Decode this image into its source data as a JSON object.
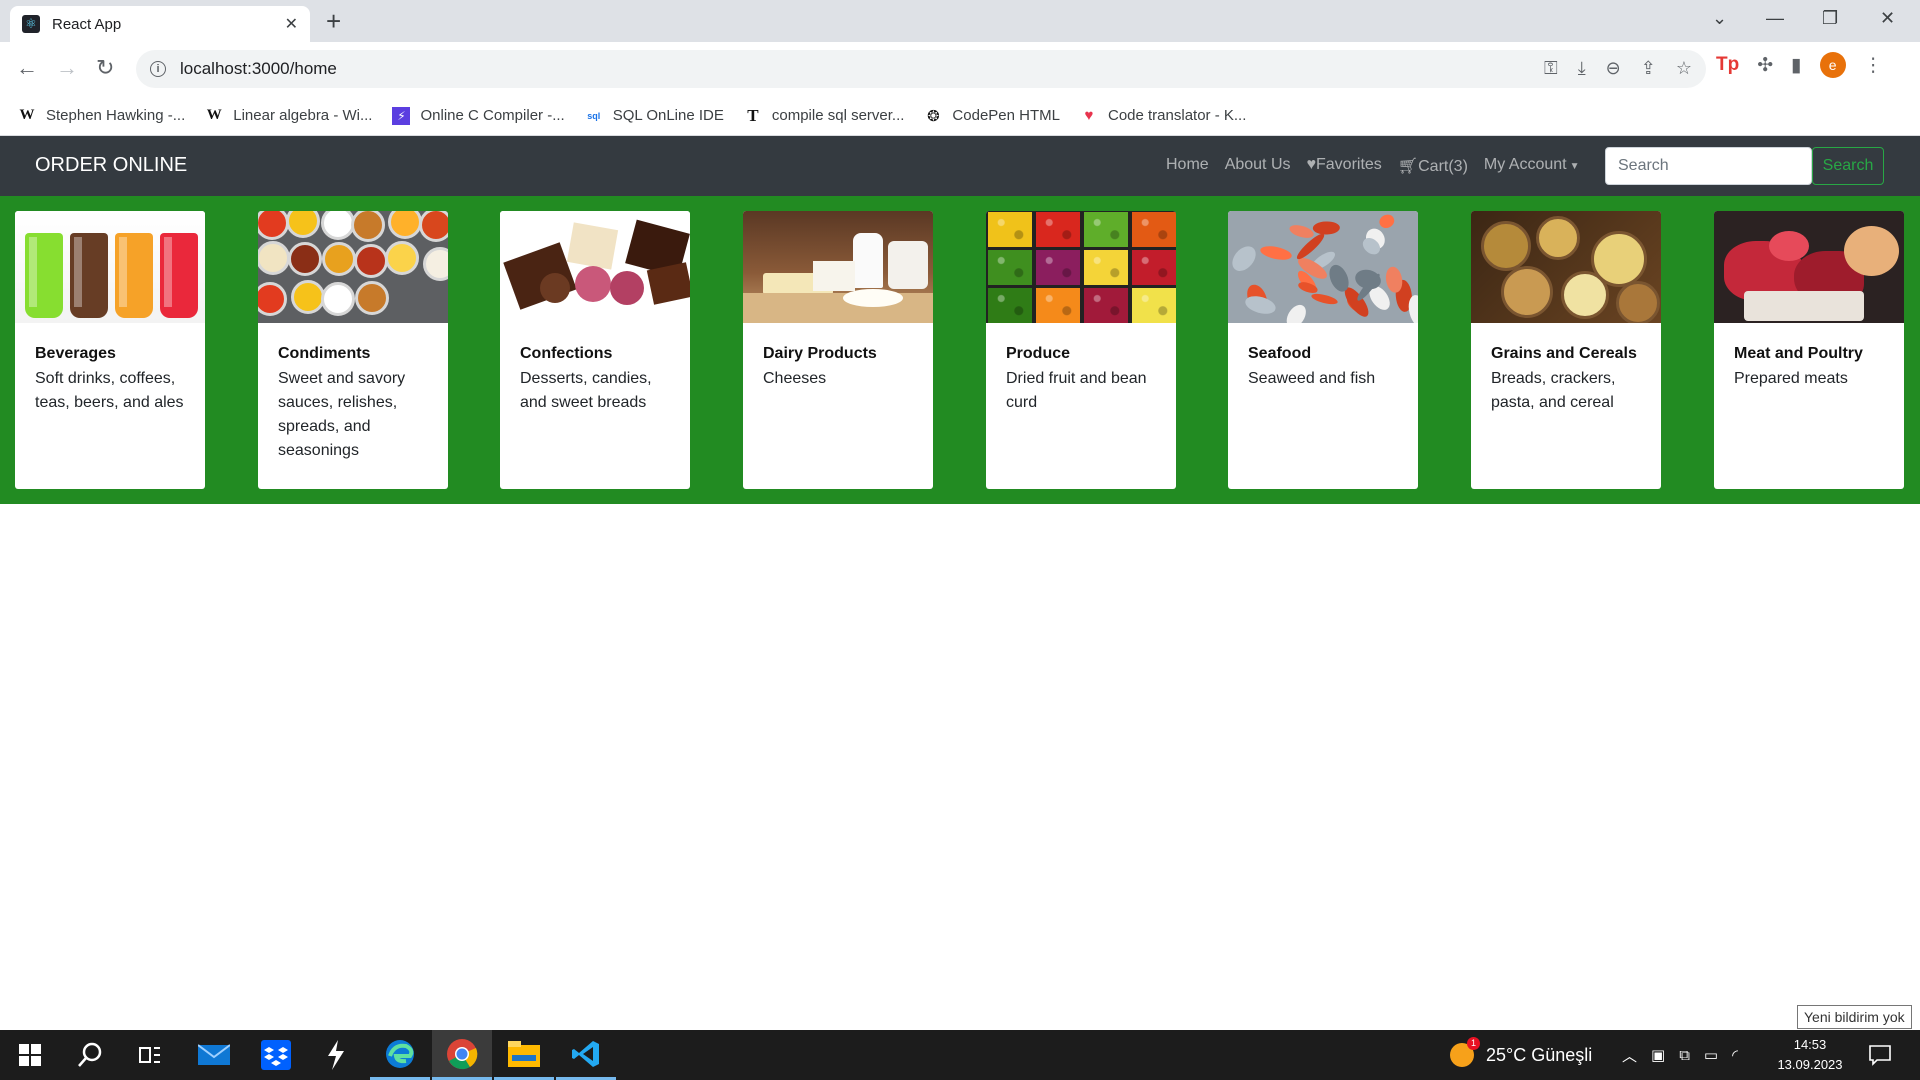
{
  "browser": {
    "tab_title": "React App",
    "url": "localhost:3000/home",
    "bookmarks": [
      {
        "icon": "W",
        "label": "Stephen Hawking -..."
      },
      {
        "icon": "W",
        "label": "Linear algebra - Wi..."
      },
      {
        "icon": "⚡",
        "label": "Online C Compiler -..."
      },
      {
        "icon": "sql",
        "label": "SQL OnLine IDE"
      },
      {
        "icon": "T",
        "label": "compile sql server..."
      },
      {
        "icon": "❂",
        "label": "CodePen HTML"
      },
      {
        "icon": "♥",
        "label": "Code translator - K..."
      }
    ],
    "avatar_letter": "e"
  },
  "app": {
    "brand": "ORDER ONLINE",
    "nav": {
      "home": "Home",
      "about": "About Us",
      "favorites": "Favorites",
      "cart": "Cart(3)",
      "account": "My Account"
    },
    "search": {
      "placeholder": "Search",
      "button": "Search"
    },
    "categories": [
      {
        "title": "Beverages",
        "description": "Soft drinks, coffees, teas, beers, and ales"
      },
      {
        "title": "Condiments",
        "description": "Sweet and savory sauces, relishes, spreads, and seasonings"
      },
      {
        "title": "Confections",
        "description": "Desserts, candies, and sweet breads"
      },
      {
        "title": "Dairy Products",
        "description": "Cheeses"
      },
      {
        "title": "Produce",
        "description": "Dried fruit and bean curd"
      },
      {
        "title": "Seafood",
        "description": "Seaweed and fish"
      },
      {
        "title": "Grains and Cereals",
        "description": "Breads, crackers, pasta, and cereal"
      },
      {
        "title": "Meat and Poultry",
        "description": "Prepared meats"
      }
    ]
  },
  "taskbar": {
    "tooltip": "Yeni bildirim yok",
    "weather": "25°C Güneşli",
    "weather_badge": "1",
    "time": "14:53",
    "date": "13.09.2023"
  },
  "colors": {
    "band": "#228b22",
    "navbar": "#343a40",
    "search_button": "#28a745"
  }
}
